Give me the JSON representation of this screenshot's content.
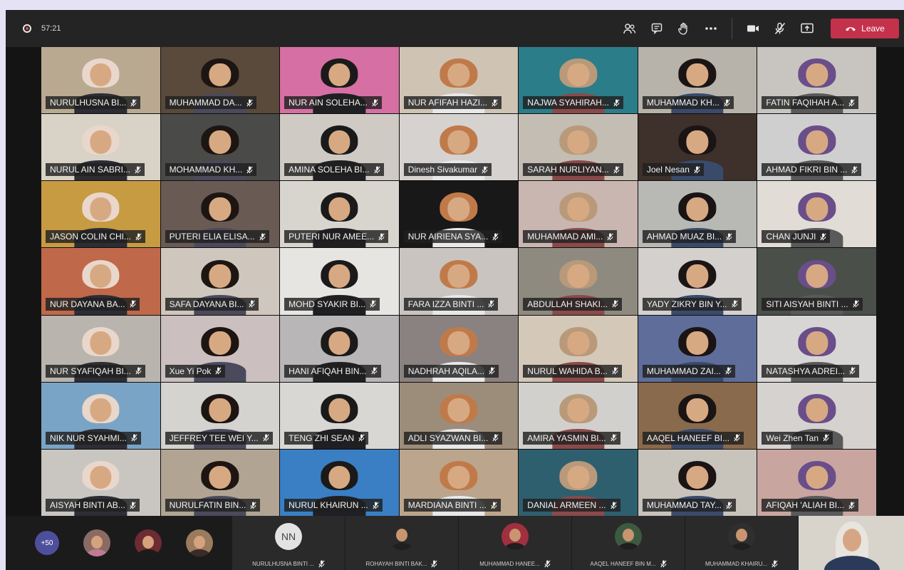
{
  "meeting": {
    "duration": "57:21",
    "leave_label": "Leave",
    "more_participants": "+50",
    "icons": [
      "participants-icon",
      "chat-icon",
      "raise-hand-icon",
      "more-icon",
      "camera-icon",
      "mic-off-icon",
      "share-icon",
      "phone-icon",
      "mic-muted-icon"
    ],
    "colors": {
      "leave": "#c4314b",
      "more_badge": "#4e4f9c"
    }
  },
  "participants": [
    {
      "name": "NURULHUSNA BI..."
    },
    {
      "name": "MUHAMMAD DA..."
    },
    {
      "name": "NUR AIN SOLEHA..."
    },
    {
      "name": "NUR AFIFAH HAZI..."
    },
    {
      "name": "NAJWA SYAHIRAH..."
    },
    {
      "name": "MUHAMMAD KH..."
    },
    {
      "name": "FATIN FAQIHAH A..."
    },
    {
      "name": "NURUL AIN SABRI..."
    },
    {
      "name": "MOHAMMAD KH..."
    },
    {
      "name": "AMINA SOLEHA BI..."
    },
    {
      "name": "Dinesh Sivakumar"
    },
    {
      "name": "SARAH NURLIYAN..."
    },
    {
      "name": "Joel Nesan"
    },
    {
      "name": "AHMAD FIKRI BIN ..."
    },
    {
      "name": "JASON COLIN CHI..."
    },
    {
      "name": "PUTERI ELIA ELISA..."
    },
    {
      "name": "PUTERI NUR AMEE..."
    },
    {
      "name": "NUR AIRIENA SYA..."
    },
    {
      "name": "MUHAMMAD AMI..."
    },
    {
      "name": "AHMAD MUAZ BI..."
    },
    {
      "name": "CHAN JUNJI"
    },
    {
      "name": "NUR DAYANA BA..."
    },
    {
      "name": "SAFA DAYANA BI..."
    },
    {
      "name": "MOHD SYAKIR BI..."
    },
    {
      "name": "FARA IZZA BINTI ..."
    },
    {
      "name": "ABDULLAH SHAKI..."
    },
    {
      "name": "YADY ZIKRY BIN Y..."
    },
    {
      "name": "SITI AISYAH BINTI ..."
    },
    {
      "name": "NUR SYAFIQAH BI..."
    },
    {
      "name": "Xue Yi Pok"
    },
    {
      "name": "HANI AFIQAH BIN..."
    },
    {
      "name": "NADHRAH AQILA..."
    },
    {
      "name": "NURUL WAHIDA B..."
    },
    {
      "name": "MUHAMMAD ZAI..."
    },
    {
      "name": "NATASHYA ADREI..."
    },
    {
      "name": "NIK NUR SYAHMI..."
    },
    {
      "name": "JEFFREY TEE WEI Y..."
    },
    {
      "name": "TENG ZHI SEAN"
    },
    {
      "name": "ADLI SYAZWAN BI..."
    },
    {
      "name": "AMIRA YASMIN BI..."
    },
    {
      "name": "AAQEL HANEEF BI..."
    },
    {
      "name": "Wei Zhen Tan"
    },
    {
      "name": "AISYAH BINTI AB..."
    },
    {
      "name": "NURULFATIN BIN..."
    },
    {
      "name": "NURUL KHAIRUN ..."
    },
    {
      "name": "MARDIANA BINTI ..."
    },
    {
      "name": "DANIAL ARMEEN ..."
    },
    {
      "name": "MUHAMMAD TAY..."
    },
    {
      "name": "AFIQAH 'ALIAH BI..."
    }
  ],
  "strip": [
    {
      "name": "NURULHUSNA BINTI ...",
      "initials": "NN"
    },
    {
      "name": "ROHAYAH BINTI BAK..."
    },
    {
      "name": "MUHAMMAD HANEE..."
    },
    {
      "name": "AAQEL HANEEF BIN M..."
    },
    {
      "name": "MUHAMMAD KHAIRU..."
    }
  ]
}
